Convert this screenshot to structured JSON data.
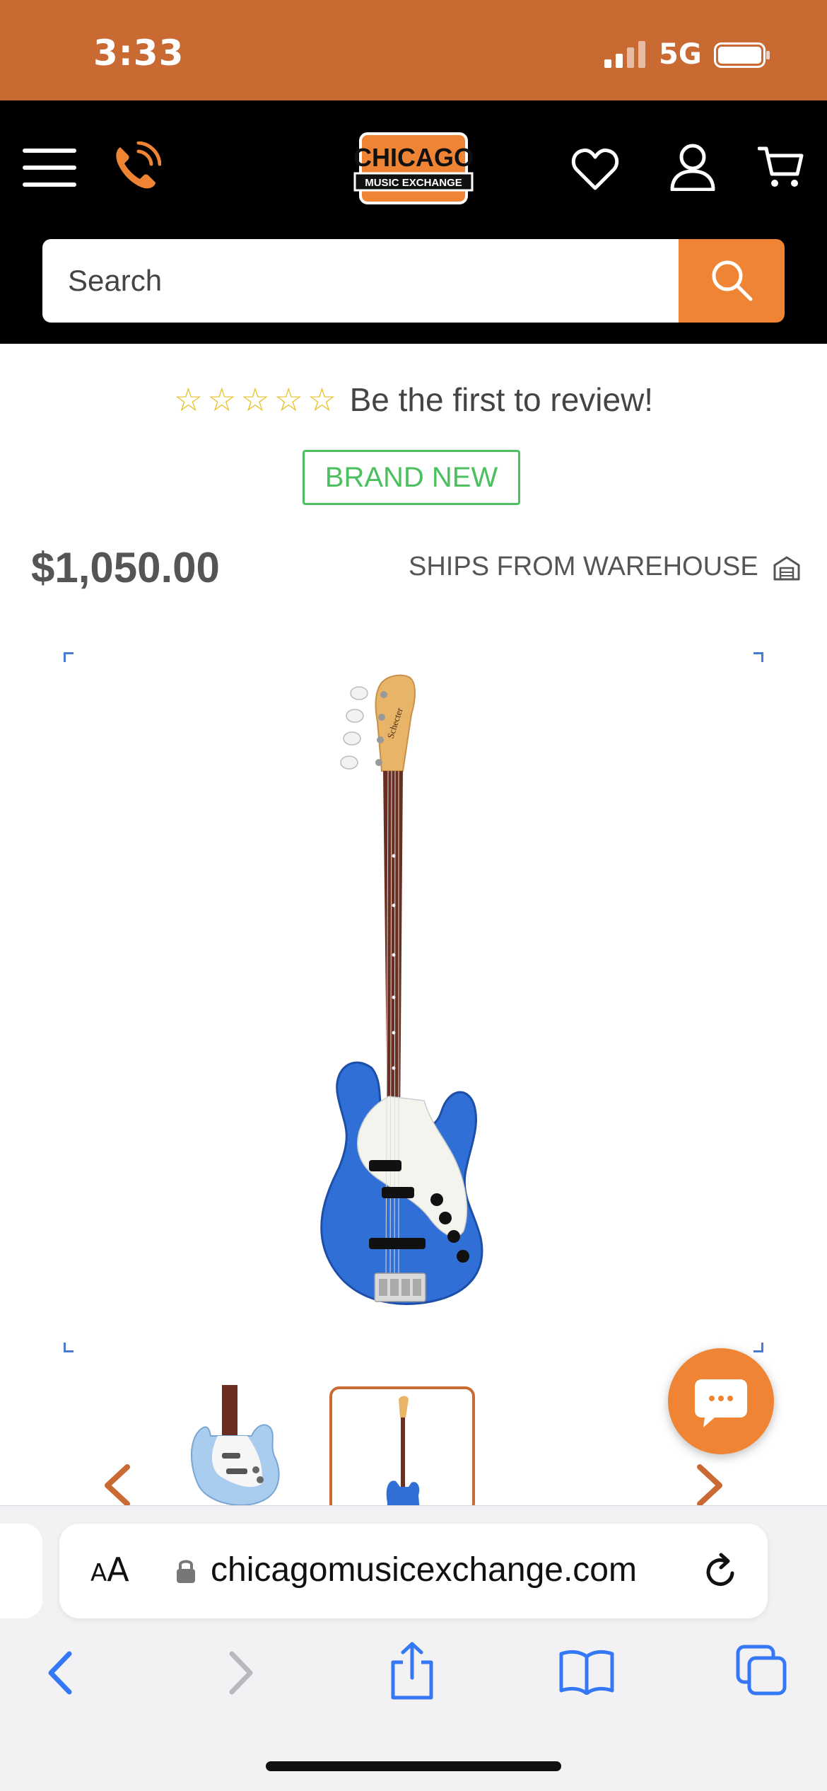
{
  "status_bar": {
    "time": "3:33",
    "network": "5G"
  },
  "header": {
    "logo_line1": "CHICAGO",
    "logo_line2": "MUSIC EXCHANGE",
    "search_placeholder": "Search"
  },
  "product": {
    "rating_stars": "☆☆☆☆☆",
    "review_prompt": "Be the first to review!",
    "condition_badge": "BRAND NEW",
    "price": "$1,050.00",
    "shipping": "SHIPS FROM WAREHOUSE"
  },
  "browser": {
    "text_size_label_small": "A",
    "text_size_label_large": "A",
    "url": "chicagomusicexchange.com"
  },
  "colors": {
    "brand_orange": "#c96a33",
    "accent_orange": "#ef8534",
    "badge_green": "#4cbf5e",
    "star_yellow": "#e6c229",
    "safari_blue": "#3478f6"
  },
  "icons": [
    "menu-icon",
    "phone-icon",
    "heart-icon",
    "user-icon",
    "cart-icon",
    "search-icon",
    "warehouse-icon",
    "chevron-left-icon",
    "chevron-right-icon",
    "chat-icon",
    "lock-icon",
    "reload-icon",
    "back-icon",
    "forward-icon",
    "share-icon",
    "bookmarks-icon",
    "tabs-icon"
  ]
}
